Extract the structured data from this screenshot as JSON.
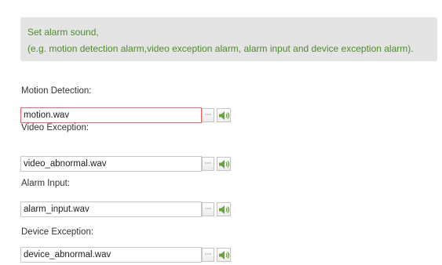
{
  "notice": {
    "line1": "Set alarm sound,",
    "line2": "(e.g. motion detection alarm,video exception alarm, alarm input and device exception alarm)."
  },
  "fields": [
    {
      "label": "Motion Detection:",
      "value": "motion.wav"
    },
    {
      "label": "Video Exception:",
      "value": "video_abnormal.wav"
    },
    {
      "label": "Alarm Input:",
      "value": "alarm_input.wav"
    },
    {
      "label": "Device Exception:",
      "value": "device_abnormal.wav"
    }
  ],
  "buttons": {
    "browse_label": "···",
    "browse_icon": "ellipsis-icon",
    "play_icon": "speaker-icon"
  },
  "colors": {
    "notice_text": "#4e8a2d",
    "notice_bg": "#e4e4e4",
    "speaker_icon": "#6aa23a",
    "focused_border": "#e06868"
  }
}
